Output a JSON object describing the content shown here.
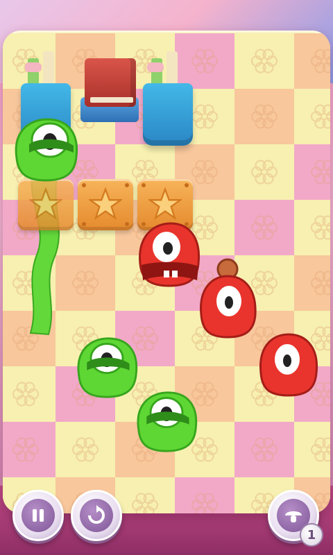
{
  "scene": {
    "description_colors": {
      "tile_yellow": "#f7f0b0",
      "tile_orange": "#f8c79c",
      "tile_pink": "#f2a9c8",
      "green_jelly": "#59d62e",
      "red_jelly": "#e8312a",
      "star_tile": "#f0a448"
    }
  },
  "hud": {
    "pause_icon": "pause-icon",
    "restart_icon": "restart-icon",
    "hint_icon": "mushroom-hint-icon",
    "hint_count": "1"
  }
}
